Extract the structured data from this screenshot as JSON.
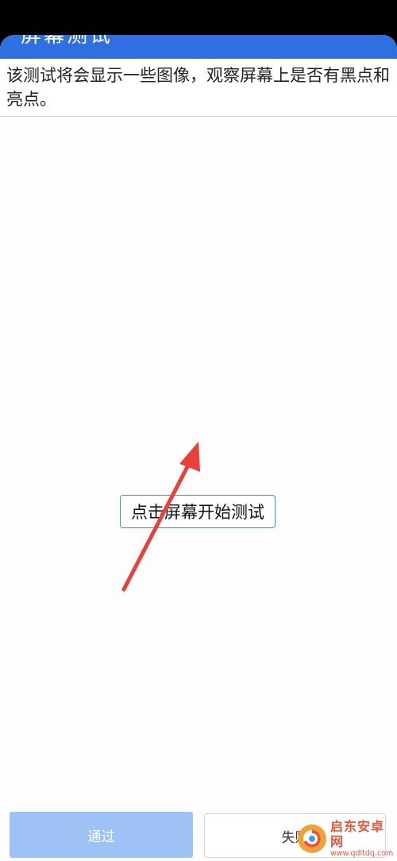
{
  "header": {
    "title": "屏幕测试"
  },
  "instruction": {
    "text": "该测试将会显示一些图像，观察屏幕上是否有黑点和亮点。"
  },
  "test_area": {
    "start_label": "点击屏幕开始测试"
  },
  "footer": {
    "pass_label": "通过",
    "fail_label": "失败"
  },
  "watermark": {
    "name": "启东安卓网",
    "url": "www.qdltdq.com"
  },
  "colors": {
    "title_bar": "#2f6fe0",
    "pass_button": "#9fc2f5",
    "button_border": "#4a86e8",
    "annotation_arrow": "#e8413c",
    "watermark": "#e8553c"
  }
}
